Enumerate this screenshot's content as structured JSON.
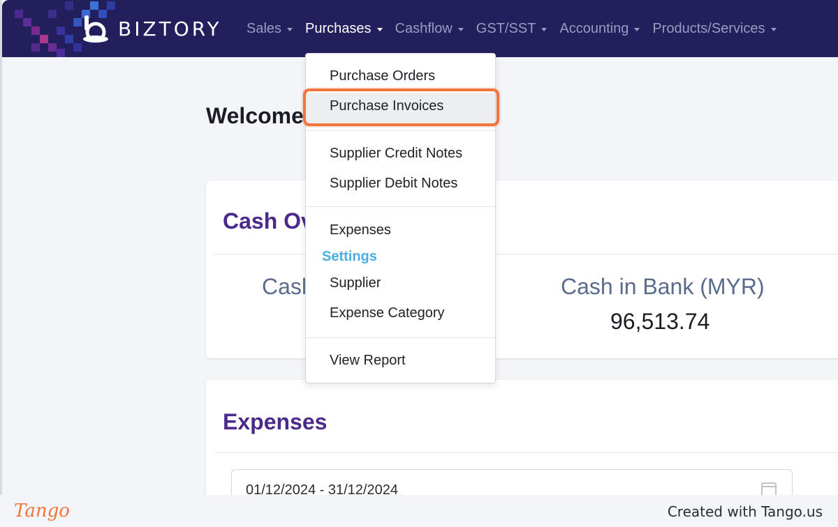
{
  "app": {
    "brand": "BIZTORY",
    "brand_color": "#231f5c",
    "accent_color": "#4b2a8c"
  },
  "nav": {
    "items": [
      {
        "label": "Sales",
        "active": false
      },
      {
        "label": "Purchases",
        "active": true
      },
      {
        "label": "Cashflow",
        "active": false
      },
      {
        "label": "GST/SST",
        "active": false
      },
      {
        "label": "Accounting",
        "active": false
      },
      {
        "label": "Products/Services",
        "active": false
      }
    ]
  },
  "dropdown": {
    "purchase_orders": "Purchase Orders",
    "purchase_invoices": "Purchase Invoices",
    "supplier_credit_notes": "Supplier Credit Notes",
    "supplier_debit_notes": "Supplier Debit Notes",
    "expenses": "Expenses",
    "settings_header": "Settings",
    "supplier": "Supplier",
    "expense_category": "Expense Category",
    "view_report": "View Report",
    "highlight_color": "#f2743d"
  },
  "main": {
    "welcome": "Welcome,",
    "cash_overview_title": "Cash Ov",
    "cash_left_label": "Cash",
    "cash_in_bank_label": "Cash in Bank (MYR)",
    "cash_in_bank_value": "96,513.74",
    "expenses_title": "Expenses",
    "date_range": "01/12/2024 - 31/12/2024"
  },
  "footer": {
    "tango": "Tango",
    "created_with": "Created with Tango.us"
  }
}
